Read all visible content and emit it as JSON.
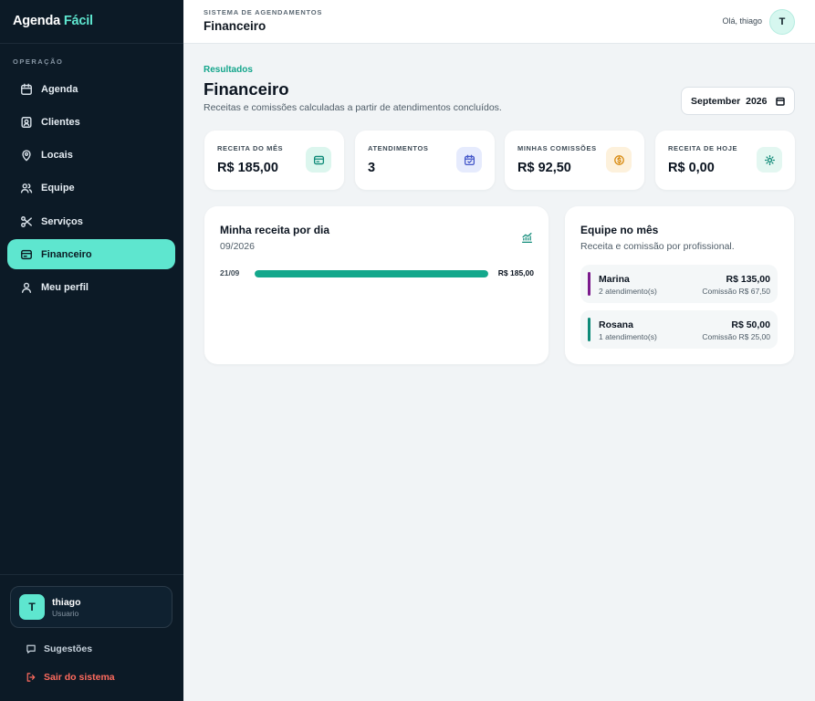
{
  "brand": {
    "name": "Agenda",
    "accent": "Fácil"
  },
  "sidebar": {
    "section_label": "OPERAÇÃO",
    "items": [
      {
        "label": "Agenda",
        "icon": "calendar-icon"
      },
      {
        "label": "Clientes",
        "icon": "contact-card-icon"
      },
      {
        "label": "Locais",
        "icon": "map-pin-icon"
      },
      {
        "label": "Equipe",
        "icon": "users-icon"
      },
      {
        "label": "Serviços",
        "icon": "scissors-icon"
      },
      {
        "label": "Financeiro",
        "icon": "wallet-icon",
        "active": true
      },
      {
        "label": "Meu perfil",
        "icon": "user-icon"
      }
    ],
    "user": {
      "initial": "T",
      "name": "thiago",
      "role": "Usuario"
    },
    "suggestions_label": "Sugestões",
    "logout_label": "Sair do sistema"
  },
  "topbar": {
    "kicker": "SISTEMA DE AGENDAMENTOS",
    "title": "Financeiro",
    "greeting": "Olá, thiago",
    "avatar_initial": "T"
  },
  "header": {
    "kicker": "Resultados",
    "title": "Financeiro",
    "subtitle": "Receitas e comissões calculadas a partir de atendimentos concluídos.",
    "month_value": "September  2026"
  },
  "stats": [
    {
      "label": "RECEITA DO MÊS",
      "value": "R$ 185,00",
      "icon": "wallet-icon"
    },
    {
      "label": "ATENDIMENTOS",
      "value": "3",
      "icon": "calendar-check-icon"
    },
    {
      "label": "MINHAS COMISSÕES",
      "value": "R$ 92,50",
      "icon": "coin-icon"
    },
    {
      "label": "RECEITA DE HOJE",
      "value": "R$ 0,00",
      "icon": "sun-icon"
    }
  ],
  "daily": {
    "title": "Minha receita por dia",
    "period": "09/2026",
    "rows": [
      {
        "day": "21/09",
        "value": "R$ 185,00",
        "fraction": 1.0
      }
    ]
  },
  "team": {
    "title": "Equipe no mês",
    "subtitle": "Receita e comissão por profissional.",
    "members": [
      {
        "name": "Marina",
        "count": "2 atendimento(s)",
        "total": "R$ 135,00",
        "commission": "Comissão R$ 67,50",
        "color": "#7b1a8c"
      },
      {
        "name": "Rosana",
        "count": "1 atendimento(s)",
        "total": "R$ 50,00",
        "commission": "Comissão R$ 25,00",
        "color": "#0f8a78"
      }
    ]
  },
  "colors": {
    "accent": "#5ee6cf",
    "sidebar_bg": "#0c1a26",
    "bar": "#14a88c",
    "logout": "#ff6b5e"
  }
}
